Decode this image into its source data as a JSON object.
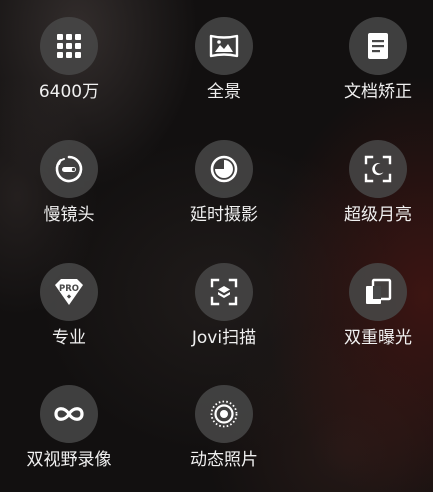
{
  "modes": [
    {
      "id": "6400w",
      "label": "6400万",
      "icon": "grid-dots-icon"
    },
    {
      "id": "panorama",
      "label": "全景",
      "icon": "panorama-icon"
    },
    {
      "id": "doc",
      "label": "文档矫正",
      "icon": "document-icon"
    },
    {
      "id": "slowmo",
      "label": "慢镜头",
      "icon": "slow-motion-icon"
    },
    {
      "id": "timelapse",
      "label": "延时摄影",
      "icon": "timelapse-icon"
    },
    {
      "id": "supermoon",
      "label": "超级月亮",
      "icon": "moon-frame-icon"
    },
    {
      "id": "pro",
      "label": "专业",
      "icon": "pro-badge-icon",
      "badge_text": "PRO"
    },
    {
      "id": "jovi",
      "label": "Jovi扫描",
      "icon": "scan-icon"
    },
    {
      "id": "double",
      "label": "双重曝光",
      "icon": "double-exposure-icon"
    },
    {
      "id": "dualview",
      "label": "双视野录像",
      "icon": "infinity-icon"
    },
    {
      "id": "live",
      "label": "动态照片",
      "icon": "live-photo-icon"
    }
  ],
  "colors": {
    "icon_fill": "#ffffff",
    "button_bg": "#484848",
    "label_text": "#f0f0f0"
  }
}
